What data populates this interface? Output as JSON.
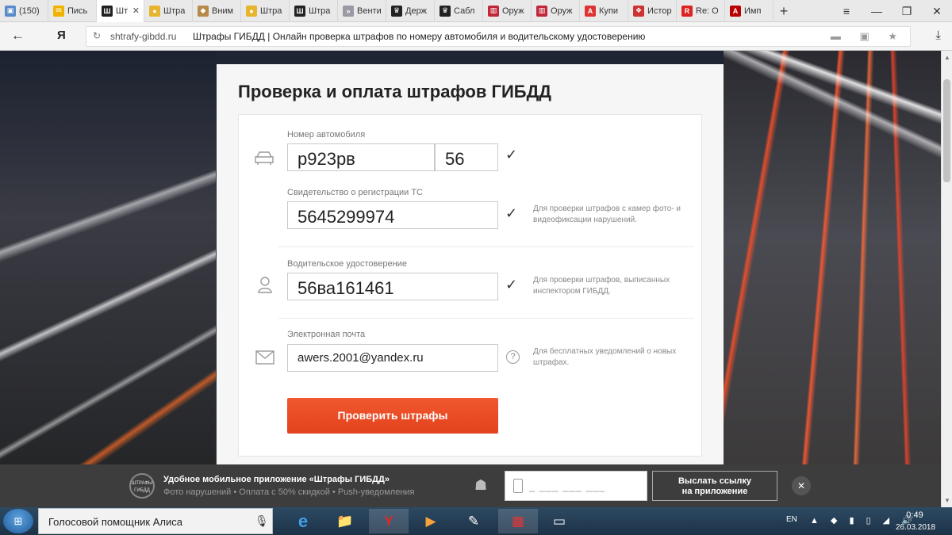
{
  "browser": {
    "tabs": [
      {
        "label": "(150)",
        "color": "#5a8ac7",
        "glyph": "▣"
      },
      {
        "label": "Пись",
        "color": "#f0b400",
        "glyph": "✉"
      },
      {
        "label": "Шт",
        "color": "#222",
        "glyph": "Ш",
        "active": true
      },
      {
        "label": "Штра",
        "color": "#e7b52d",
        "glyph": "●"
      },
      {
        "label": "Вним",
        "color": "#b88a4a",
        "glyph": "◆"
      },
      {
        "label": "Штра",
        "color": "#e7b52d",
        "glyph": "●"
      },
      {
        "label": "Штра",
        "color": "#222",
        "glyph": "Ш"
      },
      {
        "label": "Венти",
        "color": "#9a9aa5",
        "glyph": "»"
      },
      {
        "label": "Держ",
        "color": "#222",
        "glyph": "♛"
      },
      {
        "label": "Сабл",
        "color": "#222",
        "glyph": "♛"
      },
      {
        "label": "Оруж",
        "color": "#c0273a",
        "glyph": "▥"
      },
      {
        "label": "Оруж",
        "color": "#c0273a",
        "glyph": "▥"
      },
      {
        "label": "Купи",
        "color": "#d33",
        "glyph": "A"
      },
      {
        "label": "Истор",
        "color": "#c33",
        "glyph": "❖"
      },
      {
        "label": "Re: О",
        "color": "#d22",
        "glyph": "R"
      },
      {
        "label": "Имп",
        "color": "#b00",
        "glyph": "A"
      }
    ],
    "new_tab": "+",
    "window_controls": [
      "≡",
      "—",
      "❐",
      "✕"
    ],
    "back": "←",
    "logo": "Я",
    "url_domain": "shtrafy-gibdd.ru",
    "url_title": "Штрафы ГИБДД | Онлайн проверка штрафов по номеру автомобиля и водительскому удостоверению",
    "url_icons": "▬ ▣ ★",
    "download": "⤓"
  },
  "form": {
    "title": "Проверка и оплата штрафов ГИБДД",
    "car_label": "Номер автомобиля",
    "car_number": "р923рв",
    "car_region": "56",
    "sts_label": "Свидетельство о регистрации ТС",
    "sts_value": "5645299974",
    "sts_hint": "Для проверки штрафов с камер фото- и видеофиксации нарушений.",
    "license_label": "Водительское удостоверение",
    "license_value": "56ва161461",
    "license_hint": "Для проверки штрафов, выписанных инспектором ГИБДД.",
    "email_label": "Электронная почта",
    "email_value": "awers.2001@yandex.ru",
    "email_hint": "Для бесплатных уведомлений о новых штрафах.",
    "check": "✓",
    "qmark": "?",
    "submit": "Проверить штрафы"
  },
  "banner": {
    "logo": "ШТРАФЫ ГИБДД",
    "title": "Удобное мобильное приложение «Штрафы ГИБДД»",
    "subtitle": "Фото нарушений  •  Оплата с 50% скидкой  •  Push-уведомления",
    "phone_mask": "_ ___ ___ ___",
    "send_line1": "Выслать ссылку",
    "send_line2": "на приложение",
    "close": "✕"
  },
  "taskbar": {
    "start": "⊞",
    "search_text": "Голосовой помощник Алиса",
    "mic": "🎙",
    "apps": [
      "e",
      "📁",
      "Y",
      "▶",
      "✎",
      "▦",
      "▭"
    ],
    "lang": "EN",
    "tray": "▲ ◆ ▮ ▯ ◢ 🔊",
    "time": "0:49",
    "date": "26.03.2018"
  }
}
